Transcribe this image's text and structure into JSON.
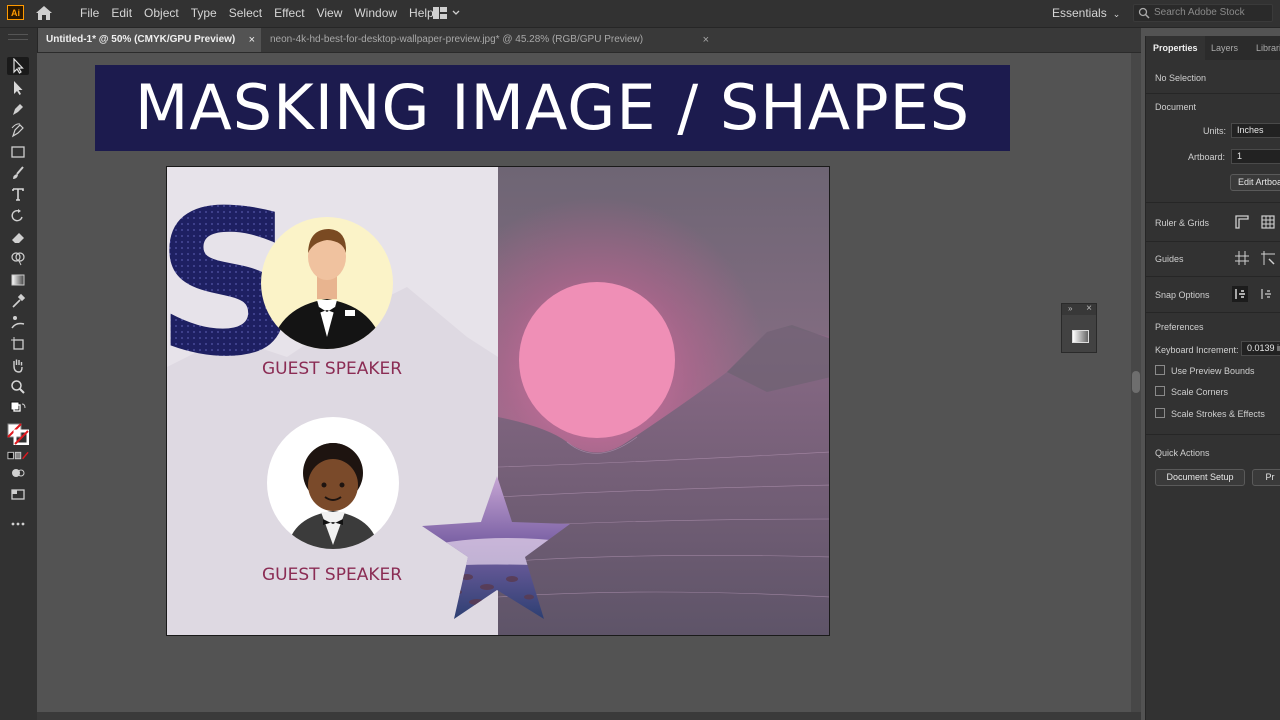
{
  "app": {
    "logo_text": "Ai"
  },
  "menu": [
    "File",
    "Edit",
    "Object",
    "Type",
    "Select",
    "Effect",
    "View",
    "Window",
    "Help"
  ],
  "workspace": {
    "label": "Essentials"
  },
  "search": {
    "placeholder": "Search Adobe Stock"
  },
  "tabs": [
    {
      "label": "Untitled-1* @ 50% (CMYK/GPU Preview)",
      "close": "×"
    },
    {
      "label": "neon-4k-hd-best-for-desktop-wallpaper-preview.jpg* @ 45.28% (RGB/GPU Preview)",
      "close": "×"
    }
  ],
  "banner": {
    "text": "MASKING IMAGE / SHAPES"
  },
  "artboard": {
    "big_letter": "S",
    "speakers": [
      {
        "label": "GUEST SPEAKER"
      },
      {
        "label": "GUEST SPEAKER"
      }
    ]
  },
  "right_panel": {
    "tabs": [
      "Properties",
      "Layers",
      "Librari"
    ],
    "selection": "No Selection",
    "document_header": "Document",
    "units_label": "Units:",
    "units_value": "Inches",
    "artboard_label": "Artboard:",
    "artboard_value": "1",
    "edit_artboards": "Edit Artboa",
    "ruler_grids": "Ruler & Grids",
    "guides": "Guides",
    "snap_options": "Snap Options",
    "preferences": "Preferences",
    "keyboard_increment_label": "Keyboard Increment:",
    "keyboard_increment_value": "0.0139 in",
    "checkboxes": [
      "Use Preview Bounds",
      "Scale Corners",
      "Scale Strokes & Effects"
    ],
    "quick_actions": "Quick Actions",
    "document_setup": "Document Setup",
    "second_button": "Pr"
  },
  "colors": {
    "banner_bg": "#1c1b4e",
    "label_color": "#8b2c54",
    "sun": "#ef8fb6",
    "accent_ai": "#ff9a00"
  }
}
